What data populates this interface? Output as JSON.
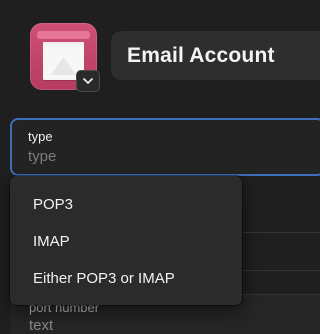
{
  "header": {
    "title": "Email Account",
    "app_icon": "mail-card-icon"
  },
  "form": {
    "type_field": {
      "label": "type",
      "placeholder": "type"
    },
    "port_field": {
      "label": "port number",
      "placeholder": "text"
    }
  },
  "dropdown": {
    "items": [
      {
        "label": "POP3"
      },
      {
        "label": "IMAP"
      },
      {
        "label": "Either POP3 or IMAP"
      }
    ]
  },
  "colors": {
    "background": "#1f1f1f",
    "icon_pink": "#cf4f76",
    "focus_border": "#3f6fb8"
  }
}
